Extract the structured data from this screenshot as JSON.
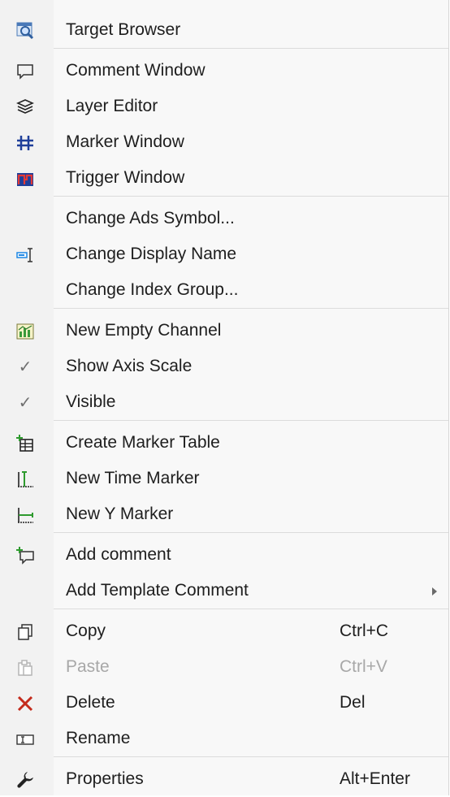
{
  "menu": {
    "items": [
      {
        "label": "Target Browser",
        "icon": "target-browser-icon"
      },
      {
        "label": "Comment Window",
        "icon": "comment-window-icon"
      },
      {
        "label": "Layer Editor",
        "icon": "layer-editor-icon"
      },
      {
        "label": "Marker Window",
        "icon": "marker-window-icon"
      },
      {
        "label": "Trigger Window",
        "icon": "trigger-window-icon"
      },
      {
        "label": "Change Ads Symbol...",
        "icon": ""
      },
      {
        "label": "Change Display Name",
        "icon": "rename-cursor-icon"
      },
      {
        "label": "Change Index Group...",
        "icon": ""
      },
      {
        "label": "New Empty Channel",
        "icon": "new-channel-icon"
      },
      {
        "label": "Show Axis Scale",
        "icon": "checkmark-icon",
        "checked": true
      },
      {
        "label": "Visible",
        "icon": "checkmark-icon",
        "checked": true
      },
      {
        "label": "Create Marker Table",
        "icon": "create-marker-table-icon"
      },
      {
        "label": "New Time Marker",
        "icon": "time-marker-icon"
      },
      {
        "label": "New Y Marker",
        "icon": "y-marker-icon"
      },
      {
        "label": "Add comment",
        "icon": "add-comment-icon"
      },
      {
        "label": "Add Template Comment",
        "icon": "",
        "submenu": true
      },
      {
        "label": "Copy",
        "icon": "copy-icon",
        "shortcut": "Ctrl+C"
      },
      {
        "label": "Paste",
        "icon": "paste-icon",
        "shortcut": "Ctrl+V",
        "disabled": true
      },
      {
        "label": "Delete",
        "icon": "delete-icon",
        "shortcut": "Del"
      },
      {
        "label": "Rename",
        "icon": "rename-icon"
      },
      {
        "label": "Properties",
        "icon": "wrench-icon",
        "shortcut": "Alt+Enter"
      }
    ],
    "check_glyph": "✓",
    "colors": {
      "background": "#f8f8f8",
      "gutter": "#f2f2f2",
      "text": "#1e1e1e",
      "disabled_text": "#a8a8a8",
      "delete_red": "#c42b1c",
      "accent_blue": "#1565c0"
    }
  }
}
